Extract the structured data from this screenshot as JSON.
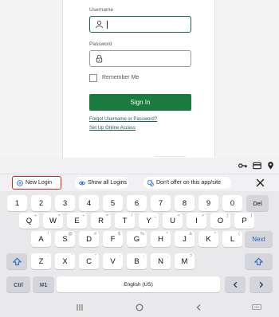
{
  "login": {
    "username_label": "Username",
    "password_label": "Password",
    "remember_label": "Remember Me",
    "signin_label": "Sign In",
    "forgot_link": "Forgot Username or Password?",
    "setup_link": "Set Up Online Access"
  },
  "autofill": {
    "icons": [
      "key-icon",
      "card-icon",
      "location-pin-icon"
    ],
    "new_login": "New Login",
    "show_all": "Show all Logins",
    "dont_offer": "Don't offer on this app/site"
  },
  "keyboard": {
    "row1": [
      {
        "label": "1"
      },
      {
        "label": "2"
      },
      {
        "label": "3"
      },
      {
        "label": "4"
      },
      {
        "label": "5"
      },
      {
        "label": "6"
      },
      {
        "label": "7"
      },
      {
        "label": "8"
      },
      {
        "label": "9"
      },
      {
        "label": "0"
      },
      {
        "label": "Del"
      }
    ],
    "row2": [
      {
        "label": "Q",
        "alt": "+"
      },
      {
        "label": "W",
        "alt": "×"
      },
      {
        "label": "E",
        "alt": "÷"
      },
      {
        "label": "R",
        "alt": "="
      },
      {
        "label": "T",
        "alt": "/"
      },
      {
        "label": "Y",
        "alt": "_"
      },
      {
        "label": "U",
        "alt": "<"
      },
      {
        "label": "I",
        "alt": ">"
      },
      {
        "label": "O",
        "alt": "["
      },
      {
        "label": "P",
        "alt": "]"
      }
    ],
    "row3": [
      {
        "label": "A",
        "alt": "!"
      },
      {
        "label": "S",
        "alt": "@"
      },
      {
        "label": "D",
        "alt": "#"
      },
      {
        "label": "F",
        "alt": "$"
      },
      {
        "label": "G",
        "alt": "%"
      },
      {
        "label": "H",
        "alt": "^"
      },
      {
        "label": "J",
        "alt": "&"
      },
      {
        "label": "K",
        "alt": "*"
      },
      {
        "label": "L",
        "alt": "("
      },
      {
        "label": "Next"
      }
    ],
    "row4": [
      {
        "label": "Z",
        "alt": "-"
      },
      {
        "label": "X",
        "alt": "'"
      },
      {
        "label": "C",
        "alt": "\""
      },
      {
        "label": "V",
        "alt": ":"
      },
      {
        "label": "B",
        "alt": ";"
      },
      {
        "label": "N",
        "alt": ","
      },
      {
        "label": "M",
        "alt": "?"
      }
    ],
    "ctrl": "Ctrl",
    "symbols": "!#1",
    "space": "English (US)"
  },
  "colors": {
    "brand_green": "#1a7a3f",
    "focus_teal": "#1f5e55",
    "next_blue": "#1a5fd0",
    "highlight_red": "#e0201f"
  }
}
